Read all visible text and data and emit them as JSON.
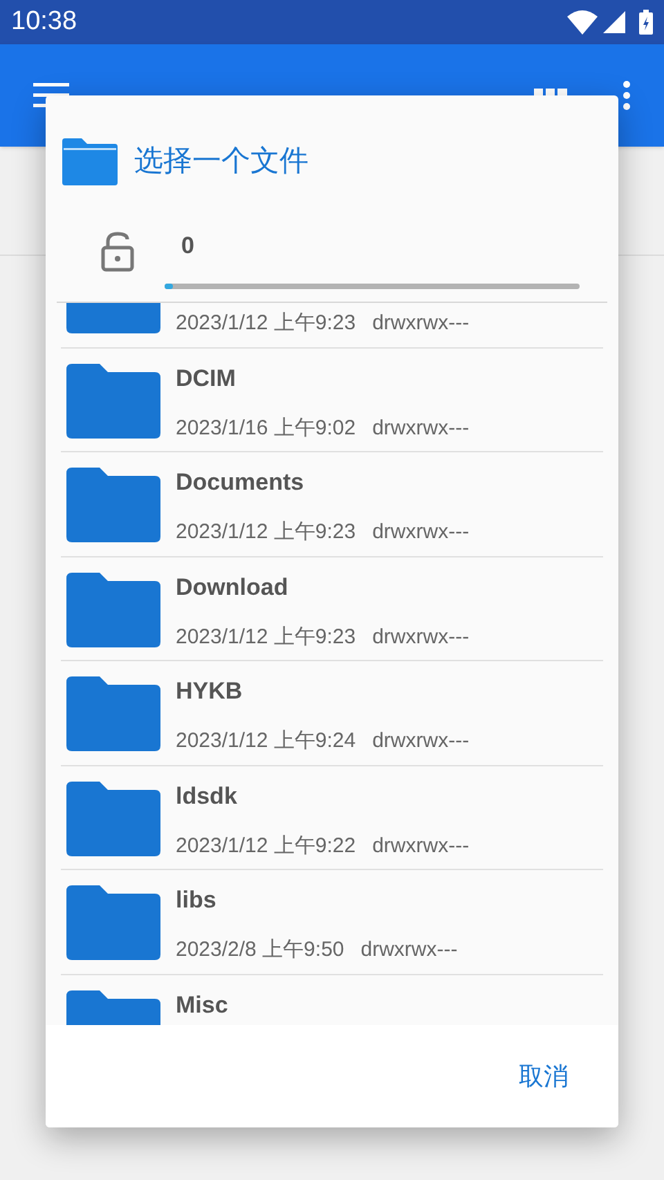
{
  "status_bar": {
    "time": "10:38"
  },
  "dialog": {
    "title": "选择一个文件",
    "lock": {
      "locked": false
    },
    "count": "0",
    "progress": {
      "level": 0.02
    },
    "items": [
      {
        "date": "2023/1/12 上午9:23",
        "permissions": "drwxrwx---"
      },
      {
        "name": "DCIM",
        "date": "2023/1/16 上午9:02",
        "permissions": "drwxrwx---"
      },
      {
        "name": "Documents",
        "date": "2023/1/12 上午9:23",
        "permissions": "drwxrwx---"
      },
      {
        "name": "Download",
        "date": "2023/1/12 上午9:23",
        "permissions": "drwxrwx---"
      },
      {
        "name": "HYKB",
        "date": "2023/1/12 上午9:24",
        "permissions": "drwxrwx---"
      },
      {
        "name": "ldsdk",
        "date": "2023/1/12 上午9:22",
        "permissions": "drwxrwx---"
      },
      {
        "name": "libs",
        "date": "2023/2/8 上午9:50",
        "permissions": "drwxrwx---"
      },
      {
        "name": "Misc"
      }
    ],
    "buttons": [
      "取消"
    ]
  }
}
